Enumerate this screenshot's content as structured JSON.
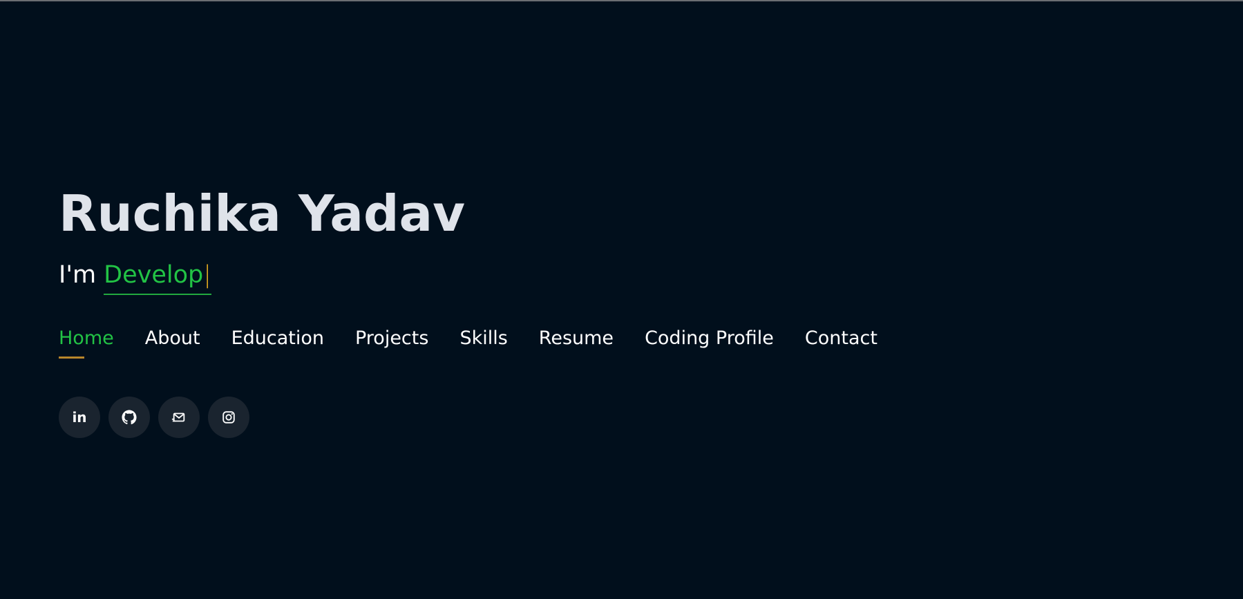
{
  "hero": {
    "name": "Ruchika Yadav",
    "intro_prefix": "I'm ",
    "typed_text": "Develop",
    "cursor": "|"
  },
  "nav": {
    "items": [
      {
        "label": "Home",
        "active": true
      },
      {
        "label": "About",
        "active": false
      },
      {
        "label": "Education",
        "active": false
      },
      {
        "label": "Projects",
        "active": false
      },
      {
        "label": "Skills",
        "active": false
      },
      {
        "label": "Resume",
        "active": false
      },
      {
        "label": "Coding Profile",
        "active": false
      },
      {
        "label": "Contact",
        "active": false
      }
    ]
  },
  "socials": {
    "linkedin_glyph": "in",
    "icons": [
      "linkedin-icon",
      "github-icon",
      "email-icon",
      "instagram-icon"
    ]
  },
  "colors": {
    "background": "#010f1c",
    "accent_green": "#22c345",
    "underline_gold": "#b8862b",
    "cursor_gold": "#e0a81f",
    "name_text": "#dfe3ea",
    "icon_bg": "#1a242f"
  }
}
